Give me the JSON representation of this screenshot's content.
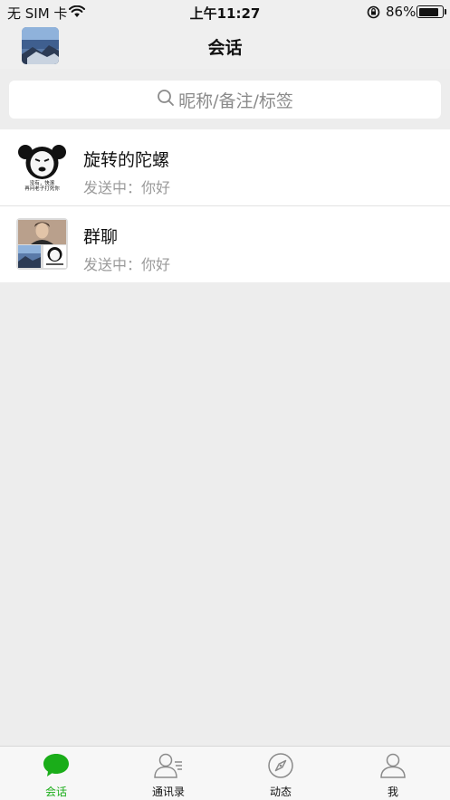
{
  "status_bar": {
    "carrier": "无 SIM 卡",
    "time": "上午11:27",
    "battery": "86%",
    "battery_level": 0.86
  },
  "nav": {
    "title": "会话"
  },
  "search": {
    "placeholder": "昵称/备注/标签"
  },
  "conversations": [
    {
      "name": "旋转的陀螺",
      "last_message": "发送中：你好",
      "avatar_caption_1": "没有，快滚",
      "avatar_caption_2": "再问老子打死你"
    },
    {
      "name": "群聊",
      "last_message": "发送中：你好"
    }
  ],
  "tabs": [
    {
      "label": "会话",
      "icon": "chat-bubble-icon",
      "active": true
    },
    {
      "label": "通讯录",
      "icon": "contacts-icon",
      "active": false
    },
    {
      "label": "动态",
      "icon": "compass-icon",
      "active": false
    },
    {
      "label": "我",
      "icon": "person-icon",
      "active": false
    }
  ],
  "colors": {
    "accent": "#1aad19",
    "background": "#ededed",
    "muted_text": "#9a9a9a"
  }
}
